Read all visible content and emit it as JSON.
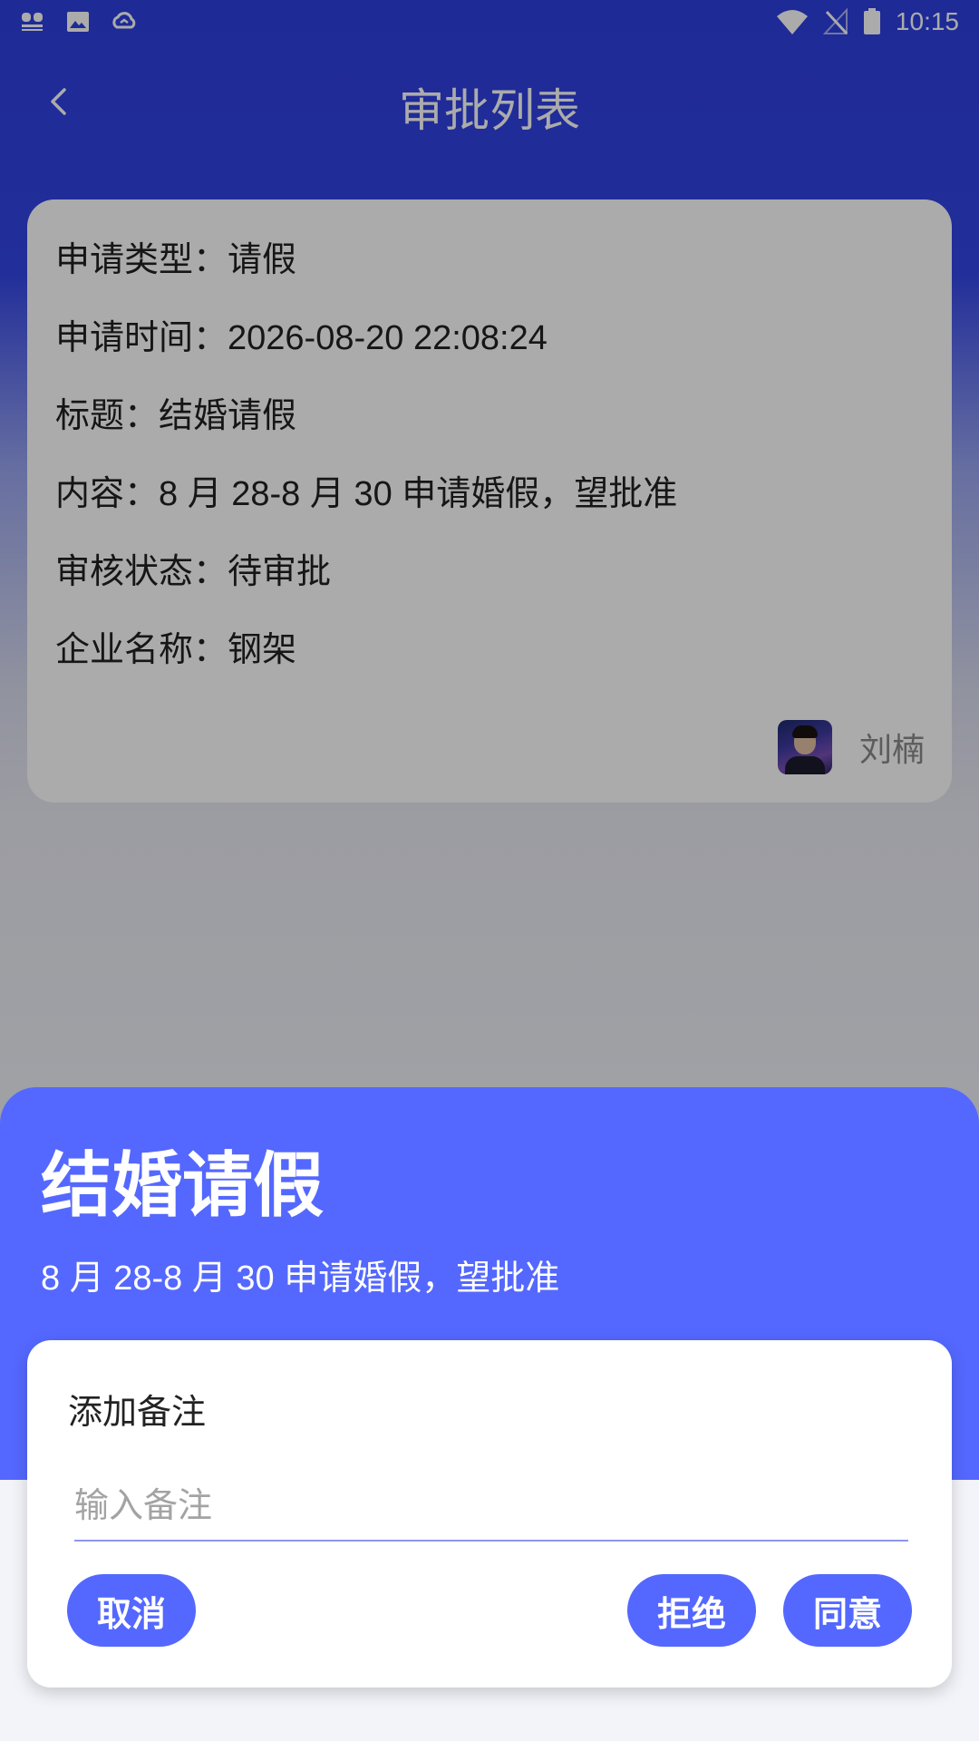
{
  "status_bar": {
    "time": "10:15",
    "left_icons": [
      "app-notification-icon",
      "gallery-icon",
      "cloud-sync-icon"
    ],
    "right_icons": [
      "wifi-icon",
      "no-signal-icon",
      "battery-icon"
    ]
  },
  "header": {
    "title": "审批列表",
    "back_icon": "chevron-left-icon"
  },
  "card": {
    "fields": [
      {
        "label": "申请类型：",
        "value": "请假"
      },
      {
        "label": "申请时间：",
        "value": "2026-08-20 22:08:24"
      },
      {
        "label": "标题：",
        "value": "结婚请假"
      },
      {
        "label": "内容：",
        "value": "8 月 28-8 月 30 申请婚假，望批准"
      },
      {
        "label": "审核状态：",
        "value": "待审批"
      },
      {
        "label": "企业名称：",
        "value": "钢架"
      }
    ],
    "applicant_name": "刘楠"
  },
  "sheet": {
    "title": "结婚请假",
    "content": "8 月 28-8 月 30 申请婚假，望批准"
  },
  "dialog": {
    "title": "添加备注",
    "input_value": "",
    "input_placeholder": "输入备注",
    "cancel_label": "取消",
    "reject_label": "拒绝",
    "agree_label": "同意"
  },
  "colors": {
    "header_blue": "#2e3fe0",
    "accent": "#5468ff",
    "input_underline": "#8c98ee"
  }
}
